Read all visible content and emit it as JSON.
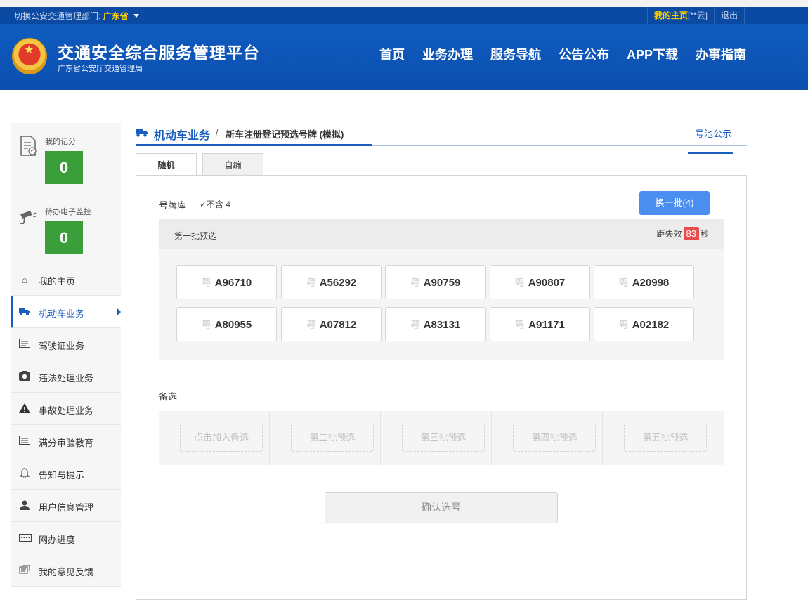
{
  "topbar": {
    "switch_label": "切换公安交通管理部门:",
    "province": "广东省",
    "home_link": "我的主页",
    "user": "[**云]",
    "logout": "退出"
  },
  "header": {
    "title": "交通安全综合服务管理平台",
    "subtitle": "广东省公安厅交通管理局",
    "nav": [
      "首页",
      "业务办理",
      "服务导航",
      "公告公布",
      "APP下载",
      "办事指南"
    ]
  },
  "sidebar": {
    "score": {
      "label": "我的记分",
      "value": "0"
    },
    "monitor": {
      "label": "待办电子监控",
      "value": "0"
    },
    "items": [
      {
        "label": "我的主页",
        "icon": "home-icon"
      },
      {
        "label": "机动车业务",
        "icon": "truck-icon"
      },
      {
        "label": "驾驶证业务",
        "icon": "card-icon"
      },
      {
        "label": "违法处理业务",
        "icon": "camera-icon"
      },
      {
        "label": "事故处理业务",
        "icon": "warning-icon"
      },
      {
        "label": "满分审验教育",
        "icon": "list-icon"
      },
      {
        "label": "告知与提示",
        "icon": "bell-icon"
      },
      {
        "label": "用户信息管理",
        "icon": "user-icon"
      },
      {
        "label": "网办进度",
        "icon": "progress-icon"
      },
      {
        "label": "我的意见反馈",
        "icon": "feedback-icon"
      }
    ]
  },
  "breadcrumb": {
    "section": "机动车业务",
    "separator": "/",
    "page": "新车注册登记预选号牌 (模拟)",
    "pool_link": "号池公示"
  },
  "tabs": [
    "随机",
    "自编"
  ],
  "panel": {
    "library_label": "号牌库",
    "exclude_four": "✓不含 4",
    "swap_button": "换一批(4)",
    "batch_title": "第一批预选",
    "countdown_prefix": "距失效",
    "countdown_value": "83",
    "countdown_suffix": "秒",
    "province_char": "粤",
    "plates": [
      "A96710",
      "A56292",
      "A90759",
      "A90807",
      "A20998",
      "A80955",
      "A07812",
      "A83131",
      "A91171",
      "A02182"
    ],
    "alt_title": "备选",
    "alt_slots": [
      "点击加入备选",
      "第二批预选",
      "第三批预选",
      "第四批预选",
      "第五批预选"
    ],
    "confirm_button": "确认选号"
  }
}
